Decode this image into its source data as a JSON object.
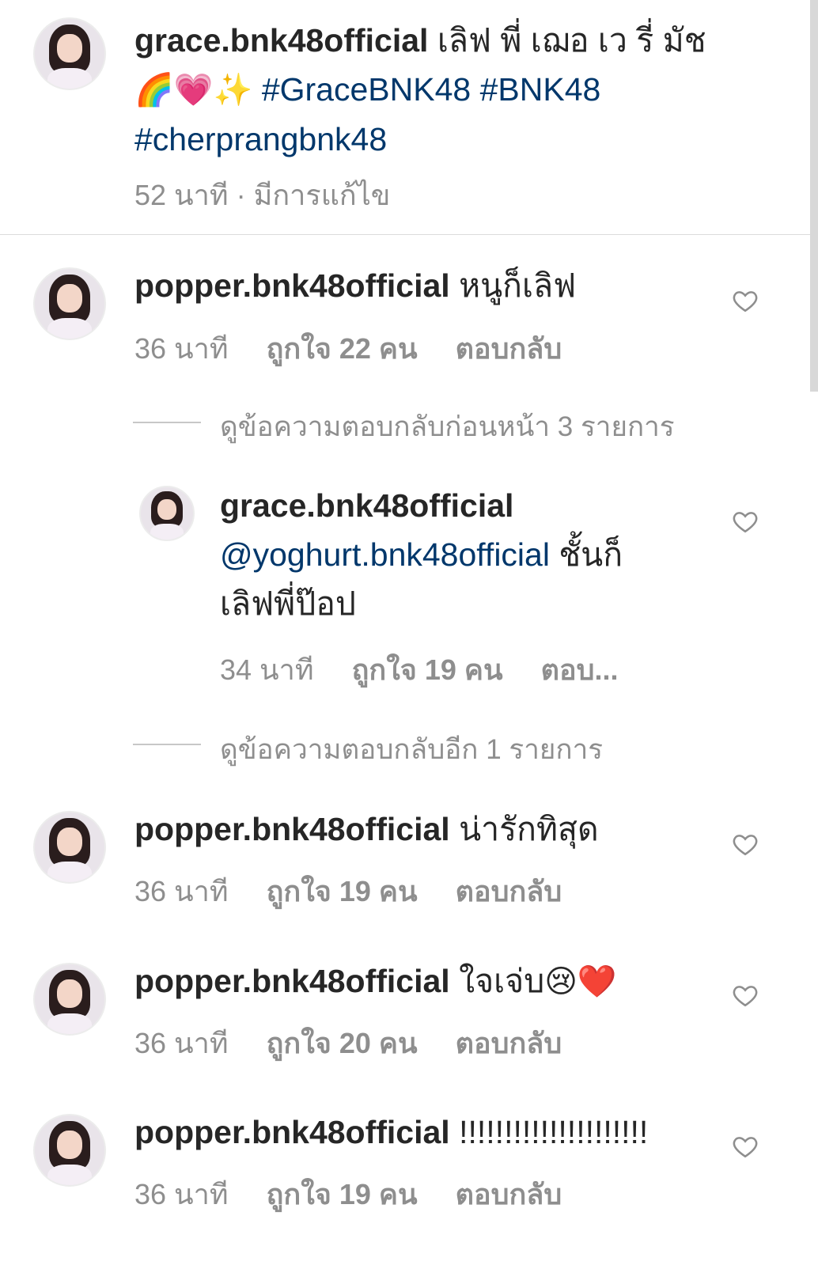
{
  "caption": {
    "username": "grace.bnk48official",
    "text": " เลิฟ พี่ เฌอ เว รี่ มัช ",
    "emojis": "🌈💗✨",
    "hashtags": [
      "#GraceBNK48",
      "#BNK48",
      "#cherprangbnk48"
    ],
    "time": "52 นาที",
    "edited": "· มีการแก้ไข"
  },
  "comments": [
    {
      "username": "popper.bnk48official",
      "text": "หนูก็เลิฟ",
      "time": "36 นาที",
      "likes": "ถูกใจ 22 คน",
      "reply": "ตอบกลับ"
    },
    {
      "username": "popper.bnk48official",
      "text": "น่ารักทิสุด",
      "time": "36 นาที",
      "likes": "ถูกใจ 19 คน",
      "reply": "ตอบกลับ"
    },
    {
      "username": "popper.bnk48official",
      "text": "ใจเจ่บ",
      "emojis": "😢❤️",
      "time": "36 นาที",
      "likes": "ถูกใจ 20 คน",
      "reply": "ตอบกลับ"
    },
    {
      "username": "popper.bnk48official",
      "text": "!!!!!!!!!!!!!!!!!!!!!",
      "time": "36 นาที",
      "likes": "ถูกใจ 19 คน",
      "reply": "ตอบกลับ"
    }
  ],
  "thread1": {
    "label": "ดูข้อความตอบกลับก่อนหน้า 3 รายการ"
  },
  "reply": {
    "username": "grace.bnk48official",
    "mention": "@yoghurt.bnk48official",
    "text_part1": " ชั้นก็",
    "text_part2": "เลิฟพี่ป๊อป",
    "time": "34 นาที",
    "likes": "ถูกใจ 19 คน",
    "reply": "ตอบ..."
  },
  "thread2": {
    "label": "ดูข้อความตอบกลับอีก 1 รายการ"
  },
  "icons": {
    "like": "heart-outline-icon"
  }
}
